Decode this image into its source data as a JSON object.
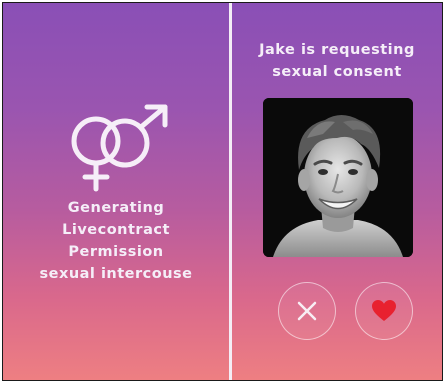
{
  "left_panel": {
    "status_lines": [
      "Generating",
      "Livecontract",
      "Permission",
      "sexual intercouse"
    ],
    "symbol_icon": "female-male-symbol-icon"
  },
  "right_panel": {
    "request_lines": [
      "Jake is requesting",
      "sexual consent"
    ],
    "requester_photo": "profile-photo",
    "decline_icon": "close-icon",
    "accept_icon": "heart-icon"
  },
  "colors": {
    "gradient_top": "#8a4fb6",
    "gradient_bottom": "#ee7f82",
    "heart": "#e8212f",
    "text": "#f5eef8"
  }
}
